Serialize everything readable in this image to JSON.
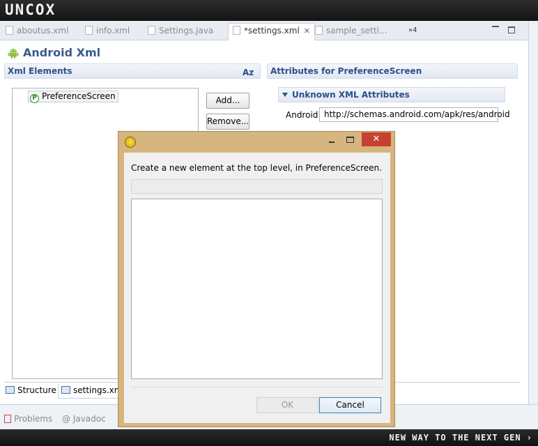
{
  "banner": {
    "brand": "UNCOX",
    "tagline": "NEW WAY TO THE NEXT GEN ›"
  },
  "editor_tabs": [
    {
      "label": "aboutus.xml",
      "active": false
    },
    {
      "label": "info.xml",
      "active": false
    },
    {
      "label": "Settings.java",
      "active": false
    },
    {
      "label": "*settings.xml",
      "active": true
    },
    {
      "label": "sample_setti...",
      "active": false
    }
  ],
  "tab_overflow": "»4",
  "editor": {
    "title": "Android Xml",
    "xml_elements_header": "Xml Elements",
    "sort_label": "Az",
    "attributes_header": "Attributes for PreferenceScreen",
    "tree_node": {
      "badge": "P",
      "label": "PreferenceScreen"
    },
    "add_button": "Add...",
    "remove_button": "Remove...",
    "unknown_attrs_header": "Unknown XML Attributes",
    "android_attr_label": "Android",
    "android_attr_value": "http://schemas.android.com/apk/res/android"
  },
  "page_tabs": [
    {
      "label": "Structure"
    },
    {
      "label": "settings.xml"
    }
  ],
  "views": [
    {
      "label": "Problems"
    },
    {
      "label": "@ Javadoc"
    }
  ],
  "dialog": {
    "close_glyph": "✕",
    "message": "Create a new element at the top level, in PreferenceScreen.",
    "filter_value": "",
    "ok_label": "OK",
    "ok_enabled": false,
    "cancel_label": "Cancel"
  },
  "colors": {
    "dialog_frame": "#d6b57f",
    "dialog_close": "#c84031",
    "section_title": "#2c4f8a"
  }
}
